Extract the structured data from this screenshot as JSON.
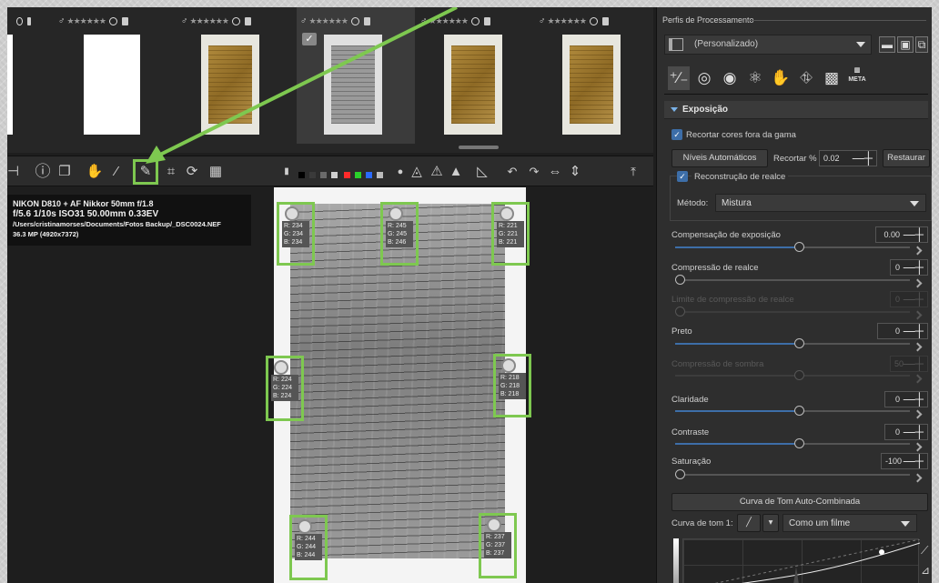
{
  "filmstrip": {
    "thumbs": [
      {
        "id": "t0",
        "kind": "partial"
      },
      {
        "id": "t1",
        "kind": "white"
      },
      {
        "id": "t2",
        "kind": "paper"
      },
      {
        "id": "t3",
        "kind": "gray",
        "selected": true,
        "checkmark": "✓"
      },
      {
        "id": "t4",
        "kind": "paper"
      },
      {
        "id": "t5",
        "kind": "paper"
      }
    ],
    "stars": "★★★★★★"
  },
  "toolbar": {
    "icons": [
      "crop-edge-icon",
      "info-icon",
      "compare-icon",
      "hand-icon",
      "color-picker-icon",
      "spot-picker-icon",
      "crop-icon",
      "straighten-icon",
      "perspective-icon"
    ],
    "swatch_colors": [
      "#000000",
      "#3a3a3a",
      "#6a6a6a",
      "#d0d0d0",
      "#ff2a2a",
      "#2ad02a",
      "#2a6aff",
      "#bbbbbb"
    ],
    "highlight_color": "#7ec850"
  },
  "info": {
    "line1": "NIKON D810 + AF Nikkor 50mm f/1.8",
    "line2": "f/5.6  1/10s  ISO31  50.00mm  0.33EV",
    "line3": "/Users/cristinamorses/Documents/Fotos Backup/_DSC0024.NEF",
    "line4": "36.3 MP (4920x7372)"
  },
  "pickers": [
    {
      "id": "p1",
      "r": "R: 234",
      "g": "G: 234",
      "b": "B: 234"
    },
    {
      "id": "p2",
      "r": "R: 245",
      "g": "G: 245",
      "b": "B: 246"
    },
    {
      "id": "p3",
      "r": "R: 221",
      "g": "G: 221",
      "b": "B: 221"
    },
    {
      "id": "p4",
      "r": "R: 224",
      "g": "G: 224",
      "b": "B: 224"
    },
    {
      "id": "p5",
      "r": "R: 218",
      "g": "G: 218",
      "b": "B: 218"
    },
    {
      "id": "p6",
      "r": "R: 244",
      "g": "G: 244",
      "b": "B: 244"
    },
    {
      "id": "p7",
      "r": "R: 237",
      "g": "G: 237",
      "b": "B: 237"
    }
  ],
  "panel": {
    "profiles_title": "Perfis de Processamento",
    "profile_value": "(Personalizado)",
    "meta_tab": "META",
    "section": "Exposição",
    "clip_oog": "Recortar cores fora da gama",
    "auto_levels": "Níveis Automáticos",
    "clip_label": "Recortar %",
    "clip_value": "0.02",
    "reset": "Restaurar",
    "hl_recon": "Reconstrução de realce",
    "method_label": "Método:",
    "method_value": "Mistura",
    "sliders": [
      {
        "id": "exp",
        "label": "Compensação de exposição",
        "value": "0.00",
        "fraction": 0.53,
        "dim": false
      },
      {
        "id": "hlc",
        "label": "Compressão de realce",
        "value": "0",
        "fraction": 0.0,
        "dim": false
      },
      {
        "id": "hlct",
        "label": "Limite de compressão de realce",
        "value": "0",
        "fraction": 0.0,
        "dim": true
      },
      {
        "id": "black",
        "label": "Preto",
        "value": "0",
        "fraction": 0.53,
        "dim": false
      },
      {
        "id": "shc",
        "label": "Compressão de sombra",
        "value": "50",
        "fraction": 0.53,
        "dim": true
      },
      {
        "id": "clar",
        "label": "Claridade",
        "value": "0",
        "fraction": 0.53,
        "dim": false
      },
      {
        "id": "contr",
        "label": "Contraste",
        "value": "0",
        "fraction": 0.53,
        "dim": false
      },
      {
        "id": "sat",
        "label": "Saturação",
        "value": "-100",
        "fraction": 0.0,
        "dim": false
      }
    ],
    "auto_curve": "Curva de Tom Auto-Combinada",
    "curve_label": "Curva de tom 1:",
    "curve_value": "Como um filme"
  }
}
